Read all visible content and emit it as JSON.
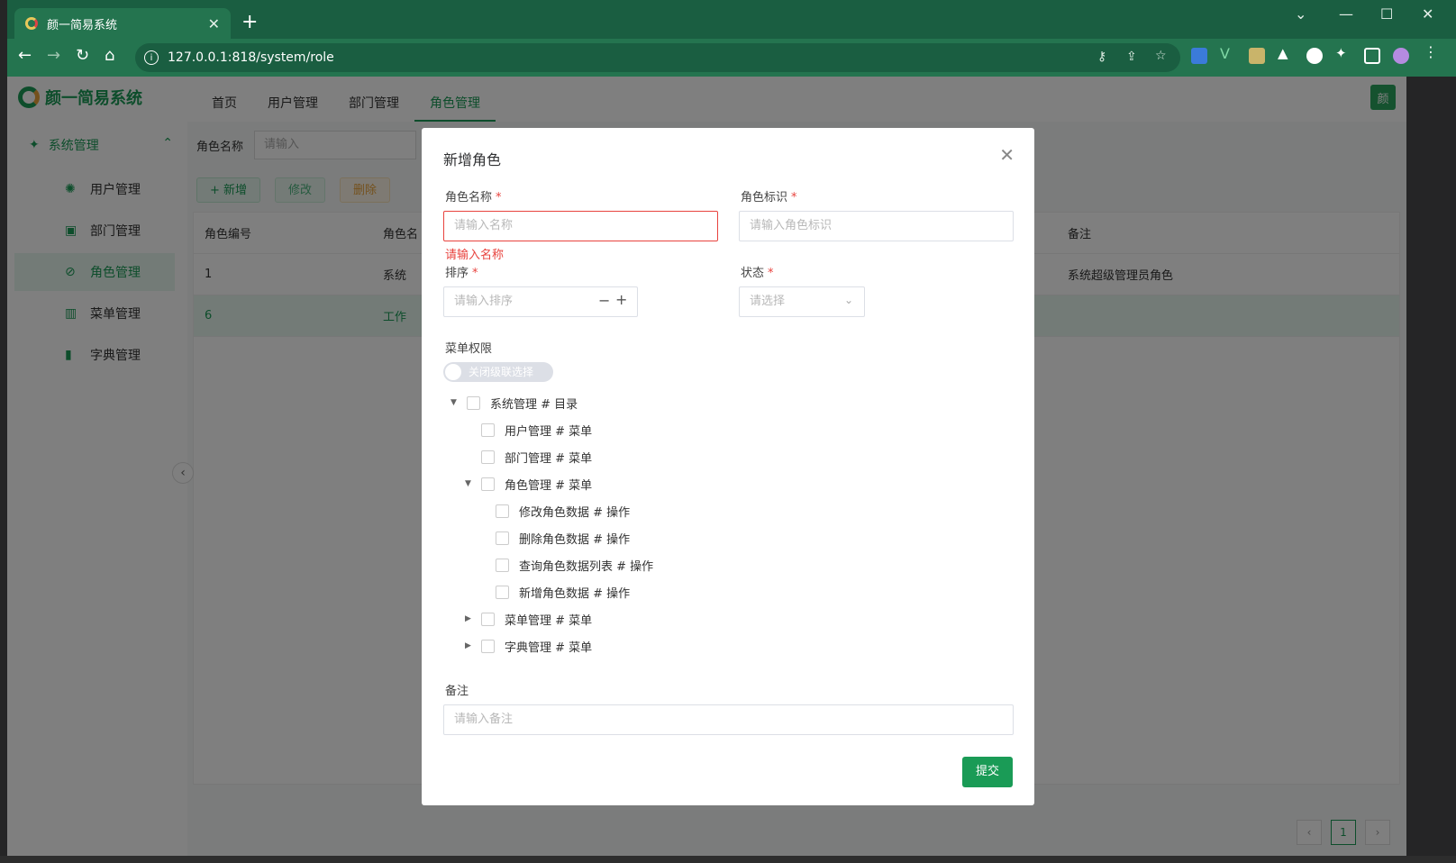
{
  "browser": {
    "tab_title": "颜一简易系统",
    "url": "127.0.0.1:818/system/role"
  },
  "app": {
    "logo_text": "颜一简易系统",
    "avatar_text": "颜",
    "top_nav": [
      "首页",
      "用户管理",
      "部门管理",
      "角色管理"
    ],
    "active_nav": "角色管理",
    "sidebar": {
      "group_label": "系统管理",
      "items": [
        "用户管理",
        "部门管理",
        "角色管理",
        "菜单管理",
        "字典管理"
      ],
      "active": "角色管理"
    },
    "search": {
      "label": "角色名称",
      "placeholder": "请输入"
    },
    "actions": {
      "add": "+ 新增",
      "edit": "修改",
      "delete": "删除"
    },
    "table": {
      "columns": [
        "角色编号",
        "角色名",
        "备注"
      ],
      "rows": [
        {
          "id": "1",
          "name": "系统",
          "remark": "系统超级管理员角色"
        },
        {
          "id": "6",
          "name": "工作",
          "remark": ""
        }
      ]
    },
    "pager": {
      "current": "1"
    }
  },
  "modal": {
    "title": "新增角色",
    "name_label": "角色名称",
    "name_placeholder": "请输入名称",
    "name_error": "请输入名称",
    "key_label": "角色标识",
    "key_placeholder": "请输入角色标识",
    "sort_label": "排序",
    "sort_placeholder": "请输入排序",
    "status_label": "状态",
    "status_placeholder": "请选择",
    "perm_label": "菜单权限",
    "cascade_switch": "关闭级联选择",
    "tree": [
      "系统管理 # 目录",
      "用户管理 # 菜单",
      "部门管理 # 菜单",
      "角色管理 # 菜单",
      "修改角色数据 # 操作",
      "删除角色数据 # 操作",
      "查询角色数据列表 # 操作",
      "新增角色数据 # 操作",
      "菜单管理 # 菜单",
      "字典管理 # 菜单"
    ],
    "remark_label": "备注",
    "remark_placeholder": "请输入备注",
    "submit": "提交"
  }
}
